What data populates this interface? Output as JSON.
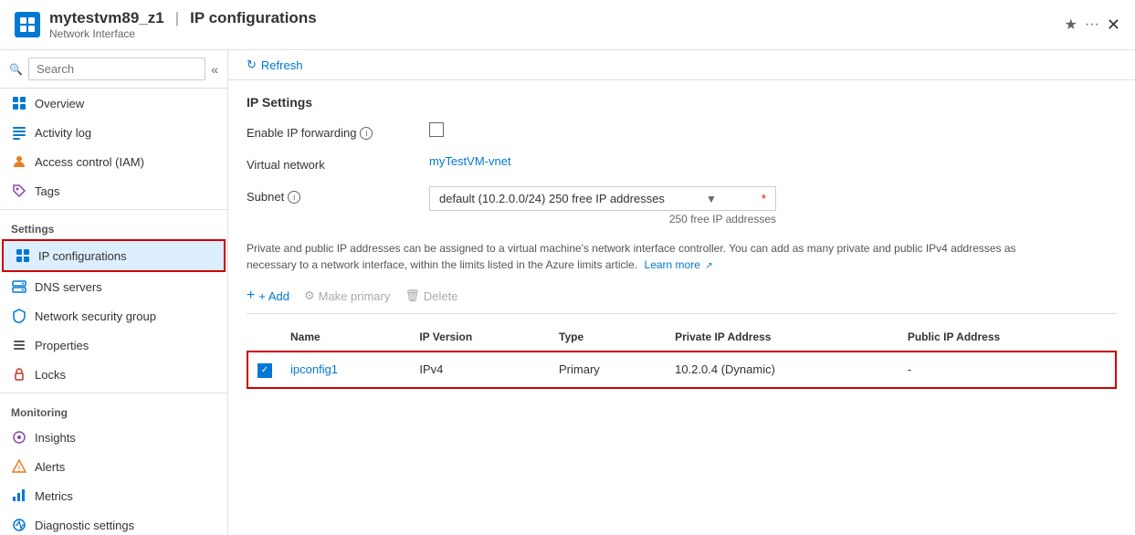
{
  "titleBar": {
    "iconText": "NI",
    "resourceName": "mytestvm89_z1",
    "separator": "|",
    "pageTitle": "IP configurations",
    "resourceType": "Network Interface",
    "starLabel": "★",
    "ellipsisLabel": "···",
    "closeLabel": "✕"
  },
  "sidebar": {
    "searchPlaceholder": "Search",
    "collapseLabel": "«",
    "navItems": [
      {
        "id": "overview",
        "label": "Overview",
        "icon": "grid",
        "active": false
      },
      {
        "id": "activity-log",
        "label": "Activity log",
        "icon": "list",
        "active": false
      },
      {
        "id": "access-control",
        "label": "Access control (IAM)",
        "icon": "person",
        "active": false
      },
      {
        "id": "tags",
        "label": "Tags",
        "icon": "tag",
        "active": false
      }
    ],
    "settingsLabel": "Settings",
    "settingsItems": [
      {
        "id": "ip-configurations",
        "label": "IP configurations",
        "icon": "grid2",
        "active": true
      },
      {
        "id": "dns-servers",
        "label": "DNS servers",
        "icon": "dns",
        "active": false
      },
      {
        "id": "network-security-group",
        "label": "Network security group",
        "icon": "shield",
        "active": false
      },
      {
        "id": "properties",
        "label": "Properties",
        "icon": "props",
        "active": false
      },
      {
        "id": "locks",
        "label": "Locks",
        "icon": "lock",
        "active": false
      }
    ],
    "monitoringLabel": "Monitoring",
    "monitoringItems": [
      {
        "id": "insights",
        "label": "Insights",
        "icon": "insight",
        "active": false
      },
      {
        "id": "alerts",
        "label": "Alerts",
        "icon": "alert",
        "active": false
      },
      {
        "id": "metrics",
        "label": "Metrics",
        "icon": "metrics",
        "active": false
      },
      {
        "id": "diagnostic-settings",
        "label": "Diagnostic settings",
        "icon": "diag",
        "active": false
      }
    ]
  },
  "toolbar": {
    "refreshLabel": "Refresh"
  },
  "content": {
    "sectionTitle": "IP Settings",
    "enableForwardingLabel": "Enable IP forwarding",
    "virtualNetworkLabel": "Virtual network",
    "virtualNetworkValue": "myTestVM-vnet",
    "subnetLabel": "Subnet",
    "subnetValue": "default (10.2.0.0/24) 250 free IP addresses",
    "subnetNote": "250 free IP addresses",
    "infoText": "Private and public IP addresses can be assigned to a virtual machine's network interface controller. You can add as many private and public IPv4 addresses as necessary to a network interface, within the limits listed in the Azure limits article.",
    "learnMoreLabel": "Learn more",
    "addLabel": "+ Add",
    "makePrimaryLabel": "Make primary",
    "deleteLabel": "Delete",
    "tableHeaders": [
      "Name",
      "IP Version",
      "Type",
      "Private IP Address",
      "Public IP Address"
    ],
    "tableRows": [
      {
        "checked": true,
        "name": "ipconfig1",
        "ipVersion": "IPv4",
        "type": "Primary",
        "privateIP": "10.2.0.4 (Dynamic)",
        "publicIP": "-"
      }
    ]
  }
}
